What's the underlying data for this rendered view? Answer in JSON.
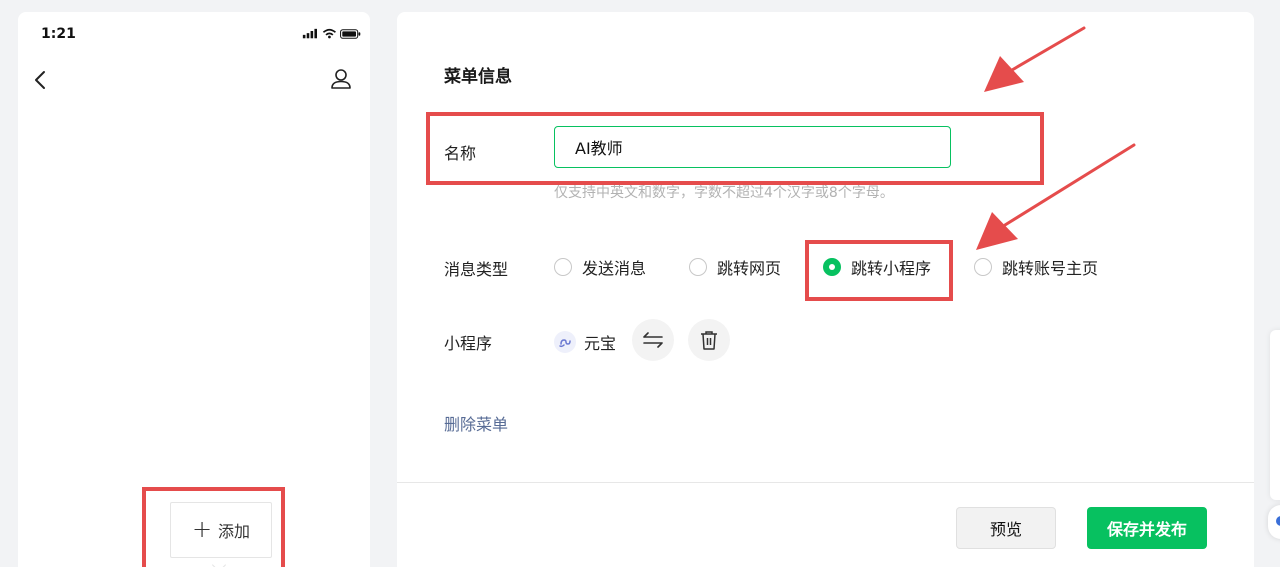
{
  "phone": {
    "time": "1:21",
    "add_label": "添加"
  },
  "panel": {
    "section_title": "菜单信息",
    "name_label": "名称",
    "name_value": "AI教师",
    "name_hint": "仅支持中英文和数字，字数不超过4个汉字或8个字母。",
    "type_label": "消息类型",
    "type_options": [
      {
        "label": "发送消息",
        "checked": false
      },
      {
        "label": "跳转网页",
        "checked": false
      },
      {
        "label": "跳转小程序",
        "checked": true
      },
      {
        "label": "跳转账号主页",
        "checked": false
      }
    ],
    "miniprogram_label": "小程序",
    "miniprogram_name": "元宝",
    "delete_label": "删除菜单"
  },
  "footer": {
    "preview_label": "预览",
    "publish_label": "保存并发布"
  },
  "colors": {
    "accent": "#07c160",
    "annotation": "#e54c4c",
    "link": "#576b95"
  }
}
